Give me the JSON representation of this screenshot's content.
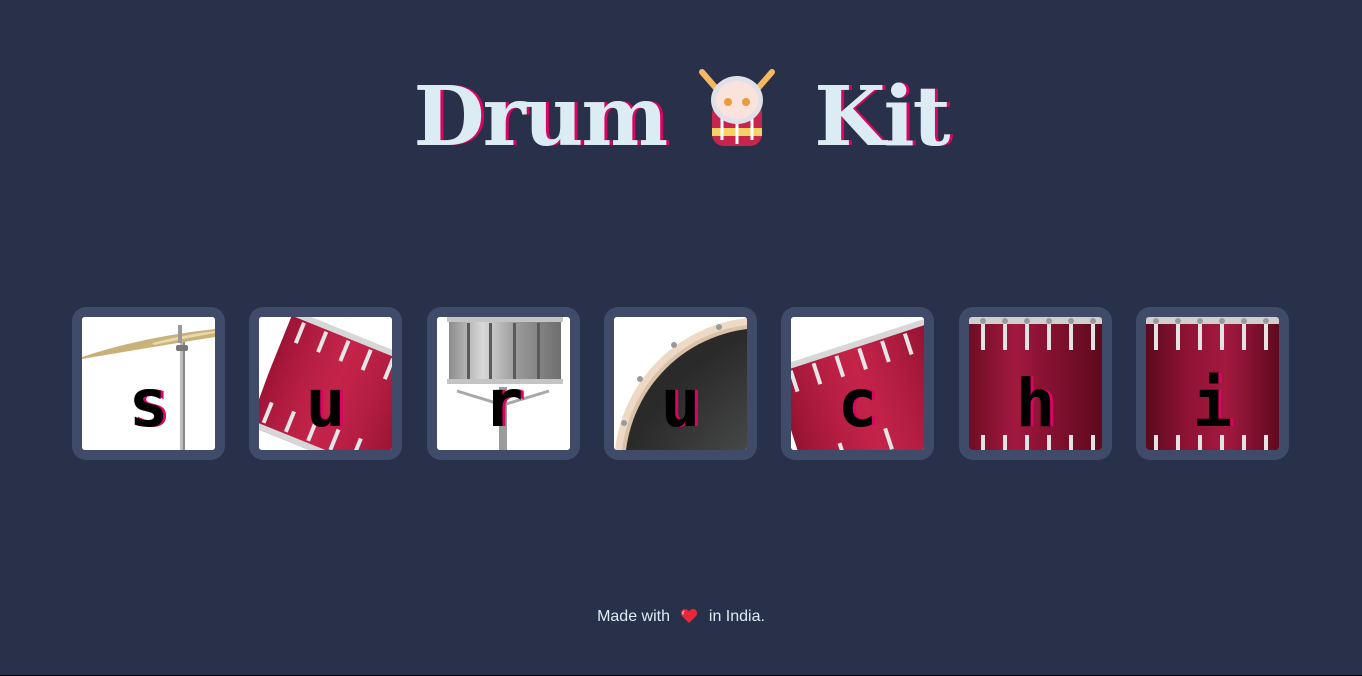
{
  "header": {
    "title_left": "Drum",
    "title_right": "Kit",
    "emoji_icon": "drum-icon"
  },
  "drums": [
    {
      "key": "s",
      "instrument_icon": "cymbal-icon"
    },
    {
      "key": "u",
      "instrument_icon": "red-tom-icon"
    },
    {
      "key": "r",
      "instrument_icon": "snare-icon"
    },
    {
      "key": "u",
      "instrument_icon": "bass-drum-icon"
    },
    {
      "key": "c",
      "instrument_icon": "red-tom-icon"
    },
    {
      "key": "h",
      "instrument_icon": "floor-tom-icon"
    },
    {
      "key": "i",
      "instrument_icon": "floor-tom-icon"
    }
  ],
  "footer": {
    "text_before": "Made with",
    "heart_icon": "heart-icon",
    "text_after": "in India."
  },
  "colors": {
    "background": "#283149",
    "pad": "#404B69",
    "title": "#DBEDF3",
    "accent": "#DA0463"
  }
}
